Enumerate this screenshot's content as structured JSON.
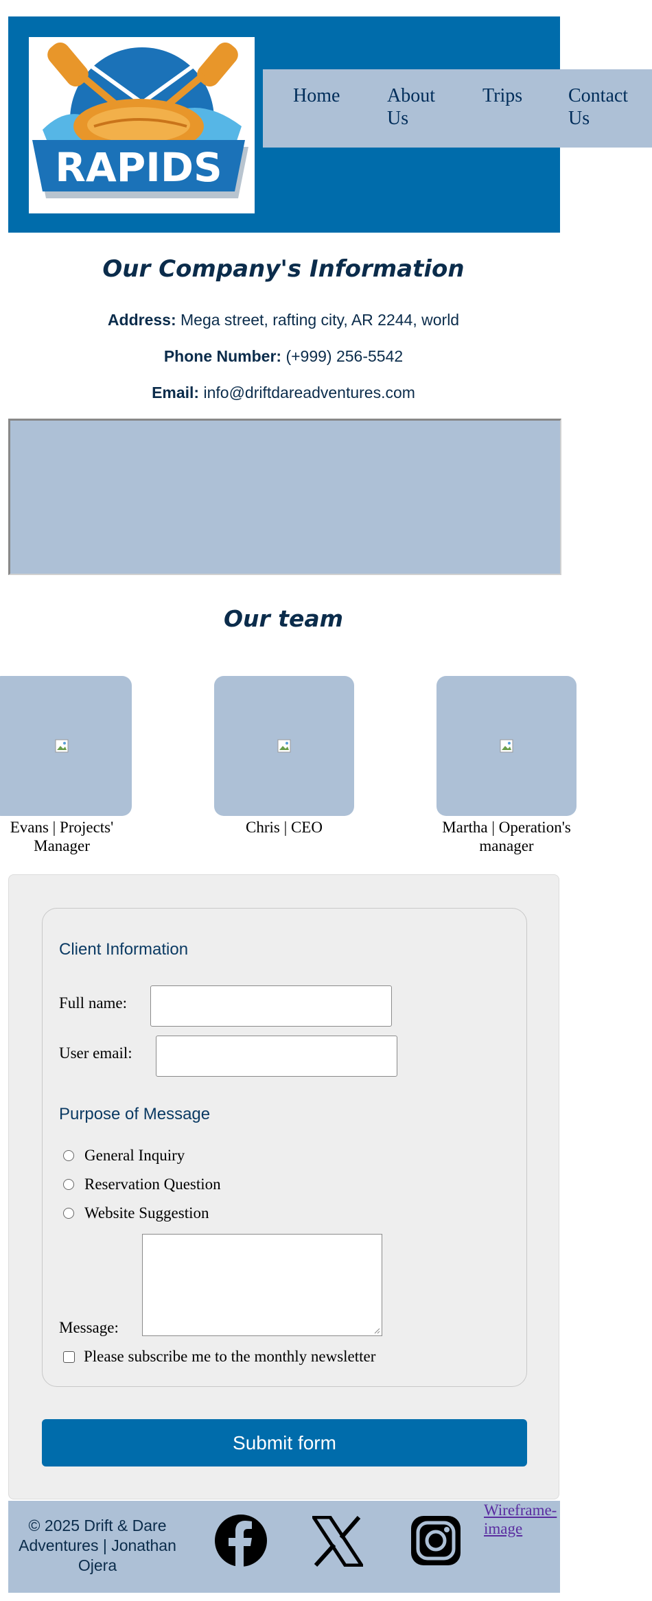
{
  "header": {
    "logo_text": "RAPIDS",
    "nav": [
      "Home",
      "About\nUs",
      "Trips",
      "Contact\nUs"
    ]
  },
  "company": {
    "title": "Our Company's Information",
    "address_label": "Address:",
    "address": "Mega street, rafting city, AR 2244, world",
    "phone_label": "Phone Number:",
    "phone": "(+999) 256-5542",
    "email_label": "Email:",
    "email": "info@driftdareadventures.com"
  },
  "team": {
    "title": "Our team",
    "members": [
      {
        "caption": "Evans | Projects' Manager"
      },
      {
        "caption": "Chris | CEO"
      },
      {
        "caption": "Martha | Operation's manager"
      }
    ]
  },
  "form": {
    "client_legend": "Client Information",
    "fullname_label": "Full name:",
    "fullname_value": "",
    "email_label": "User email:",
    "email_value": "",
    "purpose_legend": "Purpose of Message",
    "options": [
      "General Inquiry",
      "Reservation Question",
      "Website Suggestion"
    ],
    "message_label": "Message:",
    "newsletter_label": "Please subscribe me to the monthly newsletter",
    "submit_label": "Submit form"
  },
  "footer": {
    "copyright": "© 2025 Drift & Dare Adventures | Jonathan Ojera",
    "social_icons": [
      "facebook-icon",
      "x-icon",
      "instagram-icon"
    ],
    "wireframe_link": "Wireframe-image"
  },
  "colors": {
    "primary": "#006cab",
    "light": "#adc0d6",
    "heading": "#0b2c4b"
  }
}
